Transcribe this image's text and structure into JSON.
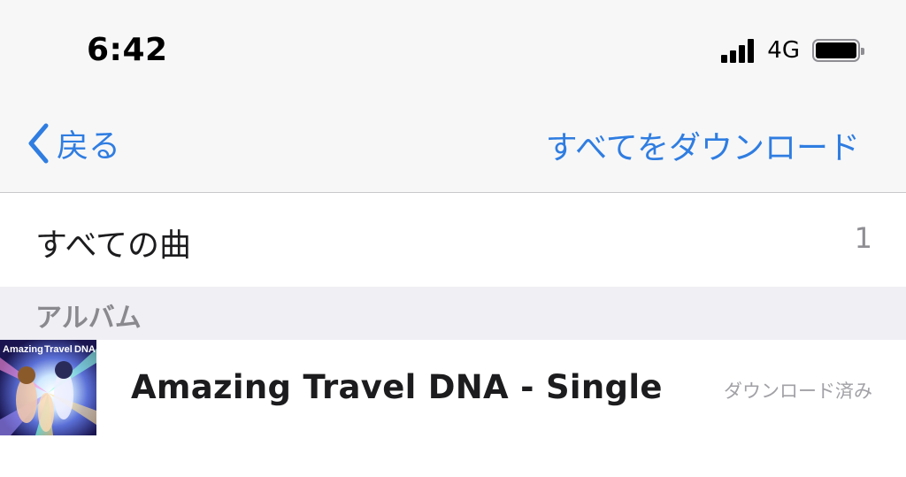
{
  "status_bar": {
    "time": "6:42",
    "network": "4G",
    "signal_icon": "cellular-signal-icon",
    "battery_icon": "battery-full-icon"
  },
  "nav": {
    "back_label": "戻る",
    "back_icon": "chevron-left-icon",
    "download_all_label": "すべてをダウンロード"
  },
  "all_songs": {
    "label": "すべての曲",
    "count": "1"
  },
  "albums_section": {
    "header": "アルバム",
    "items": [
      {
        "artwork_text_1": "Amazing",
        "artwork_text_2": "Travel",
        "artwork_text_3": "DNA",
        "title": "Amazing Travel DNA - Single",
        "status": "ダウンロード済み"
      }
    ]
  },
  "colors": {
    "accent": "#2f7de1",
    "header_bg": "#f7f7f8",
    "section_bg": "#efeff4",
    "secondary_text": "#8e8e93"
  }
}
